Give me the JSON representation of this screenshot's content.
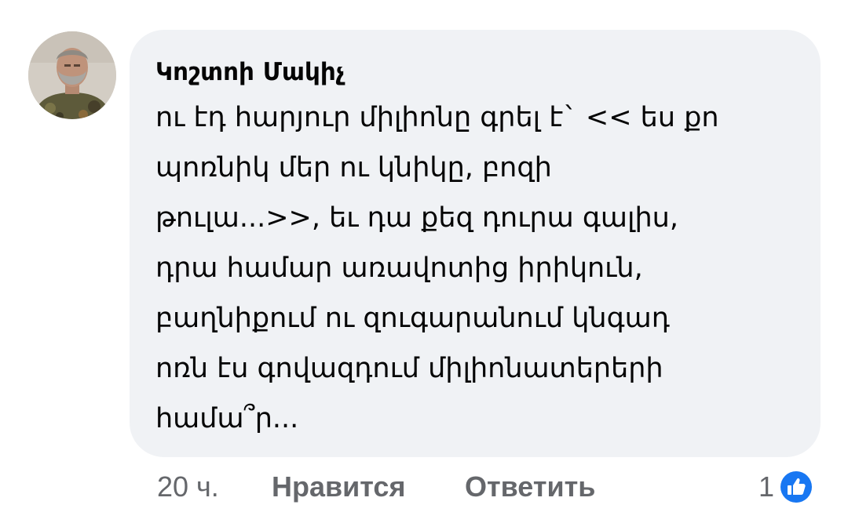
{
  "comment": {
    "author": "Կոշտոի Մակիչ",
    "text_lines": [
      "ու էդ հարյուր միլիոնը գրել է` << ես քո",
      "պոռնիկ մեր ու կնիկը, բոզի",
      "թուլա...>>, եւ դա քեզ դուրա գալիս,",
      "դրա համար առավոտից իրիկուն,",
      "բաղնիքում ու զուգարանում կնգադ",
      "ոռն էս գովազդում միլիոնատերերի",
      "համա՞ր..."
    ],
    "time": "20 ч.",
    "like_label": "Нравится",
    "reply_label": "Ответить",
    "reaction_count": "1",
    "reaction_icon": "thumbs-up-icon"
  },
  "colors": {
    "bubble_bg": "#f0f2f5",
    "text": "#050505",
    "secondary": "#65676b",
    "like_blue": "#1877f2"
  }
}
